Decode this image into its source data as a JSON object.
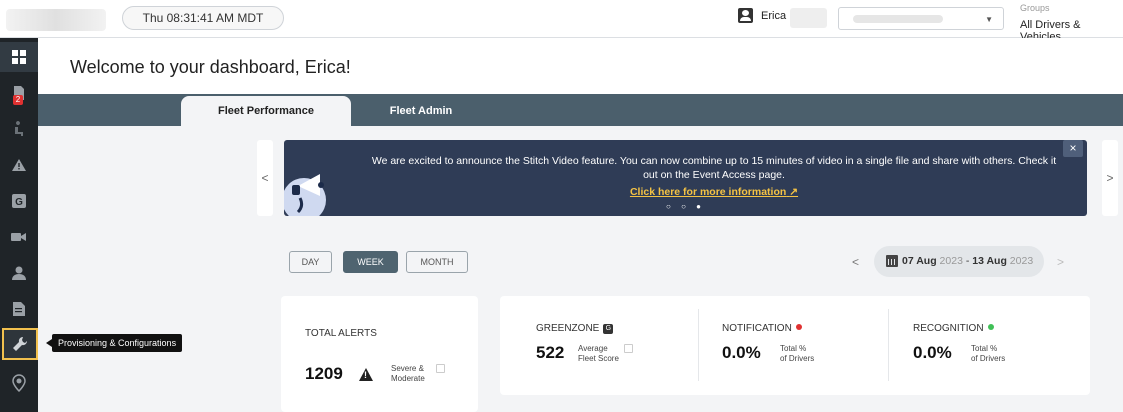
{
  "header": {
    "clock": "Thu 08:31:41 AM MDT",
    "user_name": "Erica",
    "groups_label": "Groups",
    "groups_value": "All Drivers & Vehicles"
  },
  "sidebar": {
    "badge_count": "2",
    "tooltip": "Provisioning & Configurations"
  },
  "page": {
    "welcome": "Welcome to your dashboard, Erica!"
  },
  "tabs": [
    {
      "label": "Fleet Performance",
      "active": true
    },
    {
      "label": "Fleet Admin",
      "active": false
    }
  ],
  "banner": {
    "message": "We are excited to announce the Stitch Video feature. You can now combine up to 15 minutes of video in a single file and share with others. Check it out on the Event Access page.",
    "link": "Click here for more information",
    "dots": "○ ○ ●",
    "close": "×"
  },
  "period": {
    "day": "DAY",
    "week": "WEEK",
    "month": "MONTH",
    "active": "WEEK"
  },
  "date_range": {
    "start": "07 Aug",
    "start_year": "2023",
    "separator": " - ",
    "end": "13 Aug",
    "end_year": "2023"
  },
  "metrics": {
    "total_alerts": {
      "label": "TOTAL ALERTS",
      "value": "1209",
      "desc_line1": "Severe &",
      "desc_line2": "Moderate"
    },
    "greenzone": {
      "label": "GREENZONE",
      "badge": "G",
      "value": "522",
      "desc_line1": "Average",
      "desc_line2": "Fleet Score"
    },
    "notification": {
      "label": "NOTIFICATION",
      "value": "0.0%",
      "desc_line1": "Total %",
      "desc_line2": "of Drivers",
      "dot_color": "#e03131"
    },
    "recognition": {
      "label": "RECOGNITION",
      "value": "0.0%",
      "desc_line1": "Total %",
      "desc_line2": "of Drivers",
      "dot_color": "#40c057"
    }
  }
}
